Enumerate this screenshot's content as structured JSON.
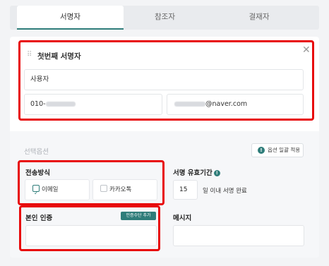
{
  "tabs": [
    {
      "label": "서명자"
    },
    {
      "label": "참조자"
    },
    {
      "label": "결재자"
    }
  ],
  "signer": {
    "title": "첫번째 서명자",
    "name_value": "사용자",
    "phone_prefix": "010-",
    "email_suffix": "@naver.com"
  },
  "options": {
    "section_label": "선택옵션",
    "bulk_apply_label": "옵션 일괄 적용",
    "delivery": {
      "title": "전송방식",
      "email_label": "이메일",
      "email_checked": true,
      "kakao_label": "카카오톡",
      "kakao_checked": false
    },
    "validity": {
      "title": "서명 유효기간",
      "days_value": "15",
      "suffix": "일 이내 서명 완료"
    },
    "auth": {
      "title": "본인 인증",
      "add_button": "인증수단 추가"
    },
    "message": {
      "title": "메시지"
    }
  },
  "colors": {
    "accent": "#2f7d7a",
    "highlight": "#e8090b"
  }
}
